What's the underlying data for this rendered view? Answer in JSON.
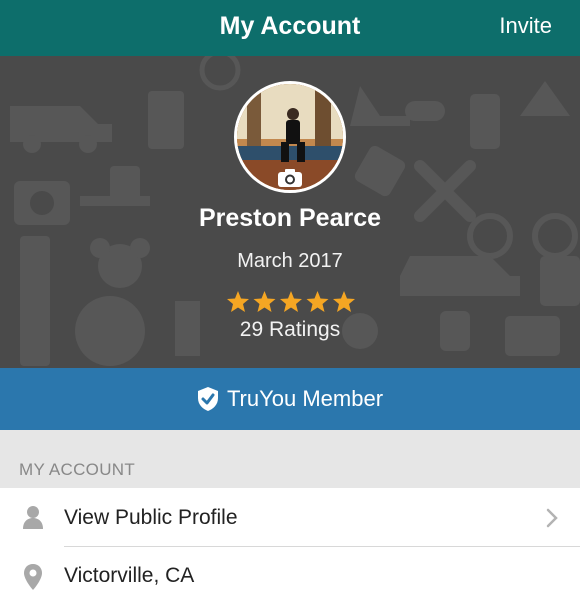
{
  "nav": {
    "title": "My Account",
    "invite_label": "Invite"
  },
  "profile": {
    "name": "Preston Pearce",
    "member_since": "March 2017",
    "rating_stars": 5,
    "ratings_text": "29 Ratings"
  },
  "badge": {
    "label": "TruYou Member"
  },
  "section": {
    "title": "MY ACCOUNT"
  },
  "rows": [
    {
      "label": "View Public Profile",
      "icon": "person-icon"
    },
    {
      "label": "Victorville, CA",
      "icon": "location-pin-icon"
    }
  ],
  "colors": {
    "nav": "#0d6e6b",
    "header": "#4a4a4a",
    "badge": "#2b77ad",
    "star": "#f5a623"
  }
}
